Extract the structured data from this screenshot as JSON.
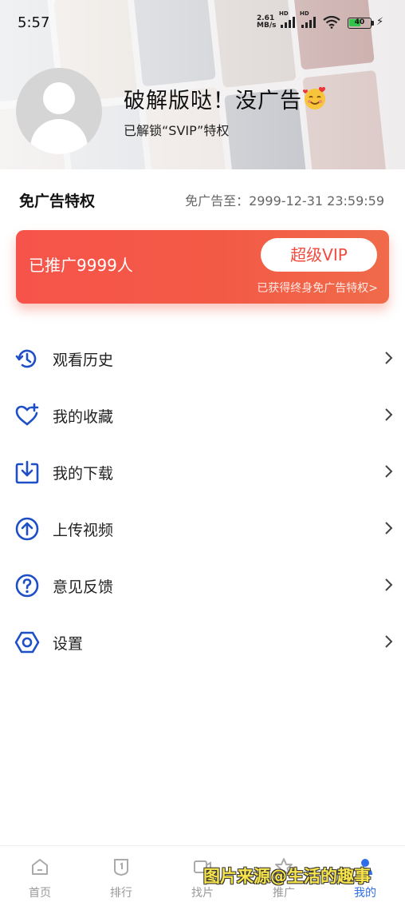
{
  "status_bar": {
    "time": "5:57",
    "net_speed": "2.61",
    "net_unit": "MB/s",
    "hd1": "HD",
    "hd2": "HD",
    "battery": "40"
  },
  "profile": {
    "username": "破解版哒！没广告",
    "emoji": "smiling-face-with-hearts",
    "unlock_text": "已解锁“SVIP”特权"
  },
  "privilege": {
    "title": "免广告特权",
    "expire_text": "免广告至：2999-12-31 23:59:59"
  },
  "vip_card": {
    "promo_text": "已推广9999人",
    "button_label": "超级VIP",
    "sub_text": "已获得终身免广告特权>",
    "gradient_start": "#f6544a",
    "gradient_end": "#f06b4a"
  },
  "menu": [
    {
      "label": "观看历史",
      "icon": "history-icon"
    },
    {
      "label": "我的收藏",
      "icon": "favorite-heart-icon"
    },
    {
      "label": "我的下载",
      "icon": "download-icon"
    },
    {
      "label": "上传视频",
      "icon": "upload-icon"
    },
    {
      "label": "意见反馈",
      "icon": "feedback-question-icon"
    },
    {
      "label": "设置",
      "icon": "settings-icon"
    }
  ],
  "tabs": [
    {
      "label": "首页",
      "icon": "home-icon",
      "active": false
    },
    {
      "label": "排行",
      "icon": "ranking-icon",
      "active": false
    },
    {
      "label": "找片",
      "icon": "video-camera-icon",
      "active": false
    },
    {
      "label": "推广",
      "icon": "promote-icon",
      "active": false
    },
    {
      "label": "我的",
      "icon": "profile-icon",
      "active": true
    }
  ],
  "watermark": "图片来源@生活的趣事",
  "colors": {
    "accent_blue": "#2f6ee8",
    "vip_red": "#f14a3e",
    "icon_blue": "#1f4fc7"
  }
}
